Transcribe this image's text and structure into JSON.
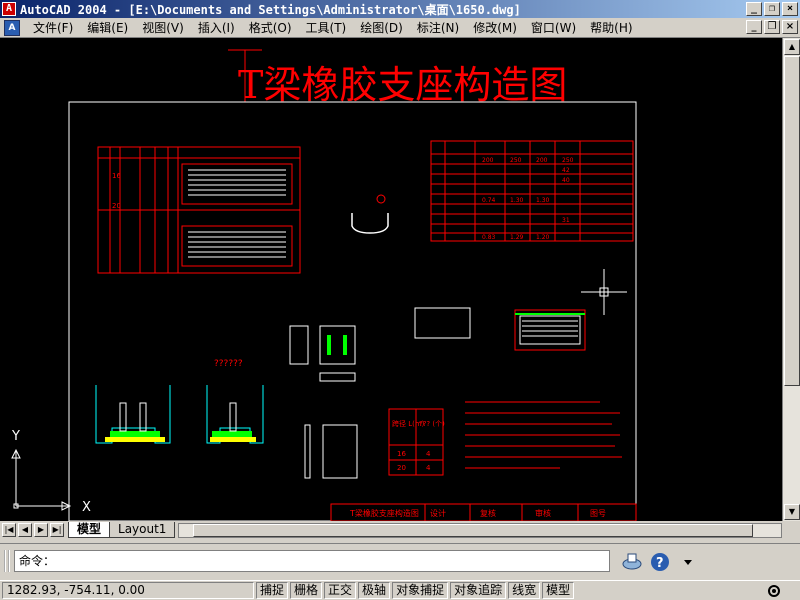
{
  "window": {
    "title": "AutoCAD 2004 - [E:\\Documents and Settings\\Administrator\\桌面\\1650.dwg]",
    "controls": {
      "minimize": "_",
      "restore": "❐",
      "close": "×"
    }
  },
  "menu": {
    "items": [
      "文件(F)",
      "编辑(E)",
      "视图(V)",
      "插入(I)",
      "格式(O)",
      "工具(T)",
      "绘图(D)",
      "标注(N)",
      "修改(M)",
      "窗口(W)",
      "帮助(H)"
    ]
  },
  "drawing": {
    "title": "T梁橡胶支座构造图",
    "title_block": {
      "name": "T梁橡胶支座构造图",
      "cols": [
        "设计",
        "复核",
        "审核",
        "图号"
      ]
    },
    "detail_caption": "??????",
    "mini_table": {
      "header": [
        "跨径 L(m)",
        "??? (个)"
      ],
      "rows": [
        [
          "16",
          "4"
        ],
        [
          "20",
          "4"
        ]
      ]
    },
    "right_table": {
      "values": [
        "200",
        "250",
        "200",
        "250",
        "42",
        "40",
        "0.74",
        "1.30",
        "1.30",
        "31",
        "0.83",
        "1.29",
        "1.20"
      ]
    },
    "left_table_spans": [
      "16",
      "20"
    ],
    "ucs": {
      "x": "X",
      "y": "Y"
    }
  },
  "layout_tabs": {
    "model": "模型",
    "layout1": "Layout1"
  },
  "command": {
    "prompt": "命令："
  },
  "status": {
    "coords": "1282.93, -754.11, 0.00",
    "toggles": [
      "捕捉",
      "栅格",
      "正交",
      "极轴",
      "对象捕捉",
      "对象追踪",
      "线宽",
      "模型"
    ]
  },
  "colors": {
    "titlebar_start": "#0a246a",
    "titlebar_end": "#a6caf0",
    "canvas_bg": "#000000",
    "drawing_red": "#ff0000",
    "drawing_white": "#ffffff",
    "drawing_cyan": "#00ffff"
  }
}
